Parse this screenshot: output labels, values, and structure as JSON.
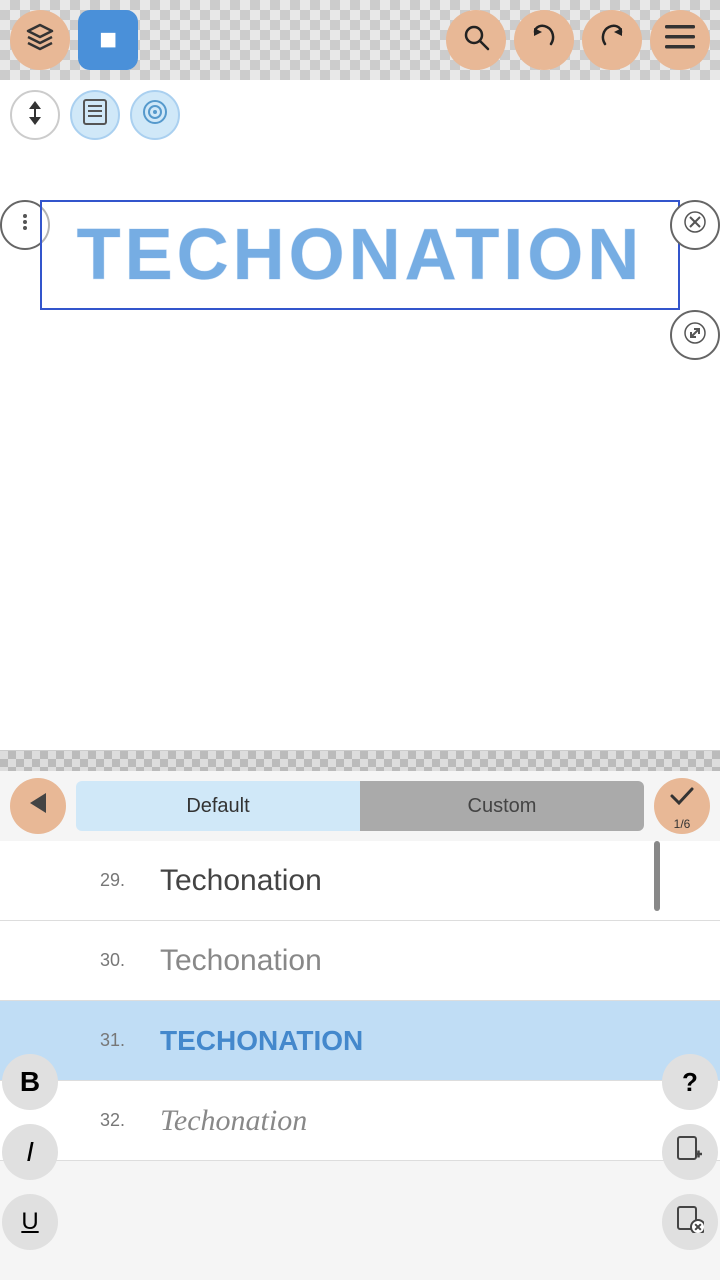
{
  "toolbar": {
    "layers_icon": "⊞",
    "square_icon": "■",
    "search_icon": "🔍",
    "undo_icon": "↩",
    "redo_icon": "↪",
    "menu_icon": "☰",
    "arrow_icon": "↕",
    "page_icon": "📄",
    "target_icon": "⊙"
  },
  "canvas": {
    "text_content": "TECHONATION",
    "close_icon": "✕",
    "resize_icon": "↙↗",
    "menu_icon": "☰"
  },
  "font_panel": {
    "back_icon": "←",
    "confirm_icon": "✓",
    "page_count": "1/6",
    "tab_default": "Default",
    "tab_custom": "Custom",
    "fonts": [
      {
        "num": "29.",
        "text": "Techonation",
        "style": "font-29",
        "selected": false
      },
      {
        "num": "30.",
        "text": "Techonation",
        "style": "font-30",
        "selected": false
      },
      {
        "num": "31.",
        "text": "TECHONATION",
        "style": "font-31",
        "selected": true
      },
      {
        "num": "32.",
        "text": "Techonation",
        "style": "font-32",
        "selected": false
      }
    ]
  },
  "side_buttons": {
    "bold_label": "B",
    "italic_label": "I",
    "underline_label": "U",
    "help_icon": "?",
    "add_page_icon": "📄+",
    "restrict_icon": "📄⊘"
  }
}
